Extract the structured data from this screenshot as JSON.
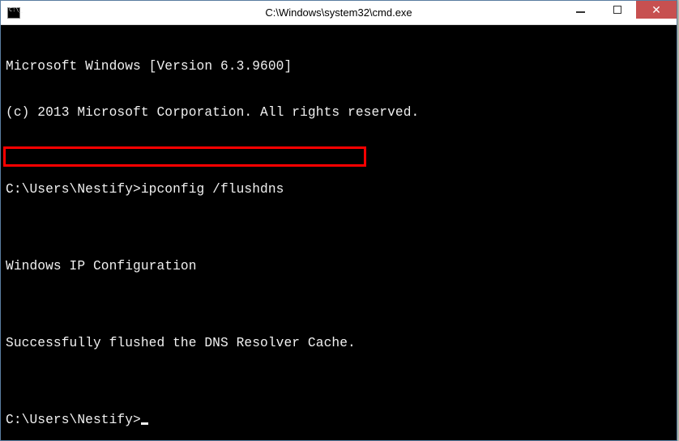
{
  "window": {
    "title": "C:\\Windows\\system32\\cmd.exe"
  },
  "terminal": {
    "line1": "Microsoft Windows [Version 6.3.9600]",
    "line2": "(c) 2013 Microsoft Corporation. All rights reserved.",
    "blank1": "",
    "prompt1_prefix": "C:\\Users\\Nestify>",
    "prompt1_command": "ipconfig /flushdns",
    "blank2": "",
    "line3": "Windows IP Configuration",
    "blank3": "",
    "line4": "Successfully flushed the DNS Resolver Cache.",
    "blank4": "",
    "prompt2_prefix": "C:\\Users\\Nestify>"
  }
}
